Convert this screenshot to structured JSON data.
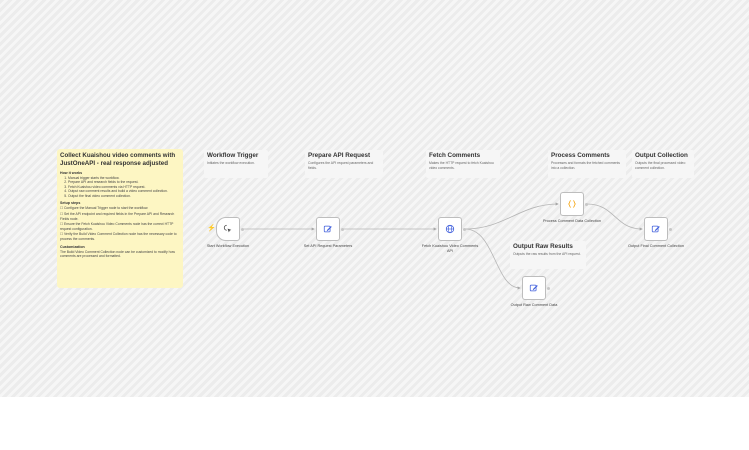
{
  "notes": {
    "title": "Collect Kuaishou video comments with JustOneAPI - real response adjusted",
    "how_heading": "How it works",
    "how_steps": [
      "Manual trigger starts the workflow.",
      "Prepare API and research fields to the request.",
      "Fetch Kuaishou video comments via HTTP request.",
      "Output raw comment results and build a video comment collection.",
      "Output the final video comment collection."
    ],
    "setup_heading": "Setup steps",
    "setup_steps": [
      "Configure the Manual Trigger node to start the workflow.",
      "Set the API endpoint and required fields in the Prepare API and Research Fields node.",
      "Ensure the Fetch Kuaishou Video Comments node has the correct HTTP request configuration.",
      "Verify the Build Video Comment Collection node has the necessary code to process the comments."
    ],
    "custom_heading": "Customization",
    "custom_text": "The Build Video Comment Collection node can be customized to modify how comments are processed and formatted."
  },
  "stickies": {
    "trigger": {
      "title": "Workflow Trigger",
      "desc": "Initiates the workflow execution."
    },
    "prepare": {
      "title": "Prepare API Request",
      "desc": "Configures the API request parameters and fields."
    },
    "fetch": {
      "title": "Fetch Comments",
      "desc": "Makes the HTTP request to fetch Kuaishou video comments."
    },
    "process": {
      "title": "Process Comments",
      "desc": "Processes and formats the fetched comments into a collection."
    },
    "output_collection": {
      "title": "Output Collection",
      "desc": "Outputs the final processed video comment collection."
    },
    "output_raw": {
      "title": "Output Raw Results",
      "desc": "Outputs the raw results from the API request."
    }
  },
  "nodes": {
    "start": {
      "label": "Start Workflow Execution",
      "icon": "cursor-click-icon"
    },
    "set_params": {
      "label": "Set API Request Parameters",
      "icon": "edit-icon"
    },
    "fetch": {
      "label": "Fetch Kuaishou Video Comments API",
      "icon": "globe-icon"
    },
    "process": {
      "label": "Process Comment Data Collection",
      "icon": "code-braces-icon"
    },
    "output_final": {
      "label": "Output Final Comment Collection",
      "icon": "edit-icon"
    },
    "output_raw": {
      "label": "Output Raw Comment Data",
      "icon": "edit-icon"
    }
  },
  "colors": {
    "trigger_bolt": "#ff6d3a",
    "note_bg": "#fdf6c3",
    "code_icon": "#f59f00"
  }
}
